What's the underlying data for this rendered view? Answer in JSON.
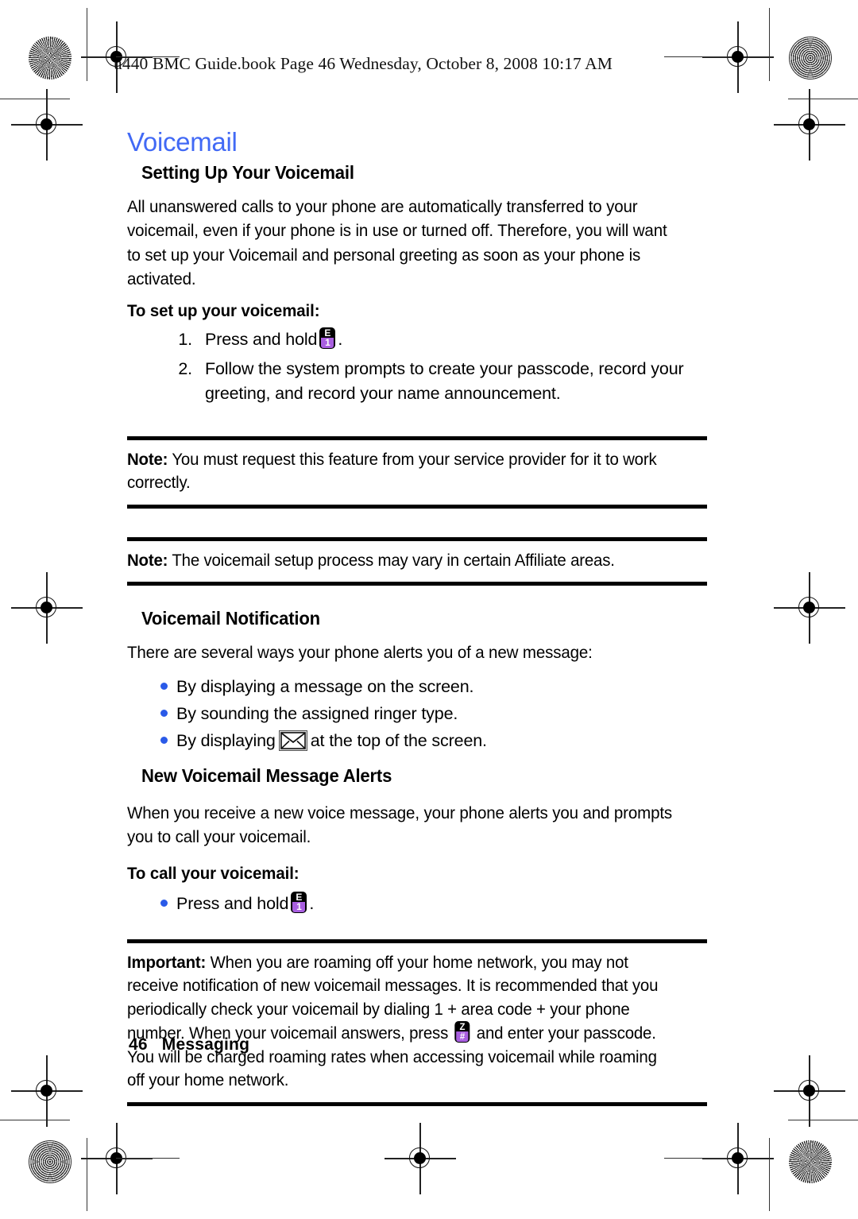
{
  "document": {
    "file_header": "u440 BMC Guide.book  Page 46  Wednesday, October 8, 2008  10:17 AM",
    "page_number": "46",
    "section_name": "Messaging"
  },
  "colors": {
    "heading_blue": "#4169f5",
    "bullet_blue": "#2a5ae8",
    "key_purple": "#a95fe0",
    "rule_black": "#000000"
  },
  "content": {
    "h1": "Voicemail",
    "setup": {
      "heading": "Setting Up Your Voicemail",
      "paragraph": "All unanswered calls to your phone are automatically transferred to your voicemail, even if your phone is in use or turned off. Therefore, you will want to set up your Voicemail and personal greeting as soon as your phone is activated.",
      "run_in": "To set up your voicemail:",
      "steps": [
        {
          "num": "1.",
          "text_before": "Press and hold",
          "key": {
            "top": "E",
            "bottom": "1",
            "name": "voicemail-key-1"
          },
          "text_after": "."
        },
        {
          "num": "2.",
          "text_before": "Follow the system prompts to create your passcode, record your greeting, and record your name announcement.",
          "key": null,
          "text_after": ""
        }
      ]
    },
    "note_1": {
      "lead": "Note:",
      "text": "You must request this feature from your service provider for it to work correctly."
    },
    "note_2": {
      "lead": "Note:",
      "text": "The voicemail setup process may vary in certain Affiliate areas."
    },
    "notification": {
      "heading": "Voicemail Notification",
      "paragraph": "There are several ways your phone alerts you of a new message:",
      "bullets": [
        {
          "text_before": "By displaying a message on the screen.",
          "icon": null,
          "text_after": ""
        },
        {
          "text_before": "By sounding the assigned ringer type.",
          "icon": null,
          "text_after": ""
        },
        {
          "text_before": "By displaying",
          "icon": "envelope-icon",
          "text_after": "at the top of the screen."
        }
      ]
    },
    "new_alerts": {
      "heading": "New Voicemail Message Alerts",
      "paragraph": "When you receive a new voice message, your phone alerts you and prompts you to call your voicemail.",
      "run_in": "To call your voicemail:",
      "bullets": [
        {
          "text_before": "Press and hold",
          "key": {
            "top": "E",
            "bottom": "1",
            "name": "voicemail-key-1"
          },
          "text_after": "."
        }
      ]
    },
    "important": {
      "lead": "Important:",
      "part_1": "When you are roaming off your home network, you may not receive notification of new voicemail messages. It is recommended that you periodically check your voicemail by dialing 1 + area code + your phone number. When your voicemail answers, press",
      "key": {
        "top": "Z",
        "bottom": "#",
        "name": "pound-key"
      },
      "part_2": "and enter your passcode. You will be charged roaming rates when accessing voicemail while roaming off your home network."
    }
  }
}
